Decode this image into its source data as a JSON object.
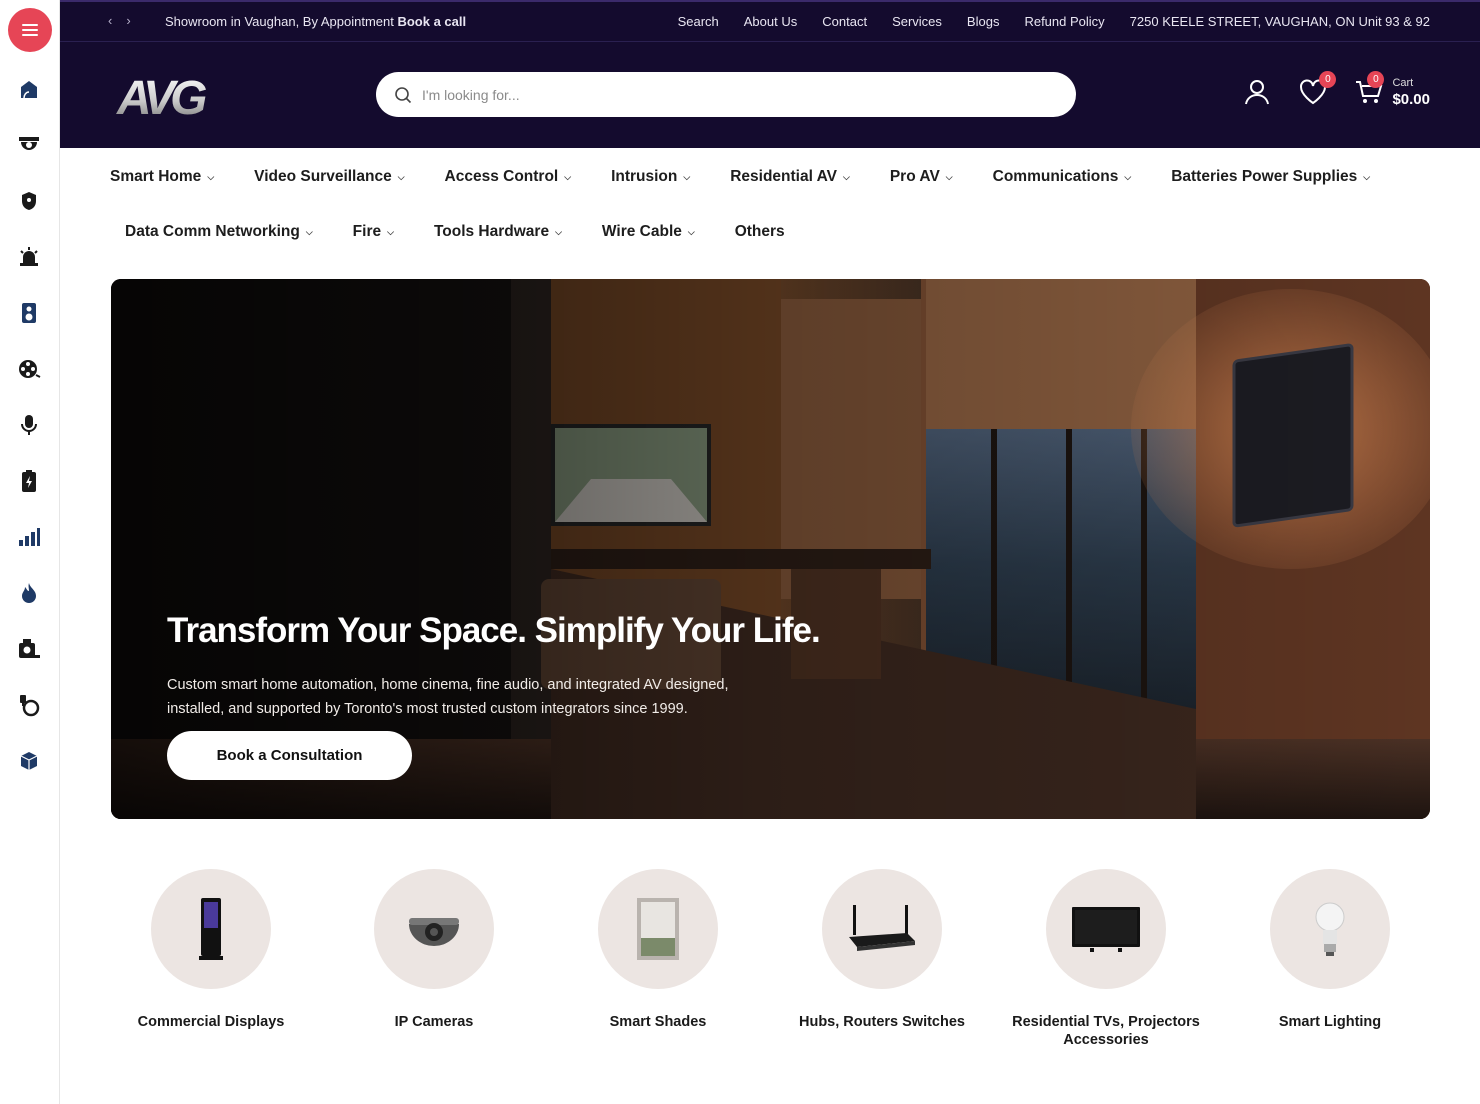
{
  "topbar": {
    "promo_text": "Showroom in Vaughan, By Appointment ",
    "promo_link": "Book a call",
    "links": [
      "Search",
      "About Us",
      "Contact",
      "Services",
      "Blogs",
      "Refund Policy",
      "7250 KEELE STREET, VAUGHAN, ON Unit 93 & 92"
    ]
  },
  "header": {
    "logo_text": "AVG",
    "search_placeholder": "I'm looking for...",
    "wishlist_count": "0",
    "cart_count": "0",
    "cart_label": "Cart",
    "cart_total": "$0.00"
  },
  "nav": {
    "row1": [
      "Smart Home",
      "Video Surveillance",
      "Access Control",
      "Intrusion",
      "Residential AV",
      "Pro AV",
      "Communications",
      "Batteries Power Supplies"
    ],
    "row2": [
      "Data Comm Networking",
      "Fire",
      "Tools Hardware",
      "Wire Cable",
      "Others"
    ]
  },
  "hero": {
    "title": "Transform Your Space. Simplify Your Life.",
    "subtitle": "Custom smart home automation, home cinema, fine audio, and integrated AV designed, installed, and supported by Toronto's most trusted custom integrators since 1999.",
    "cta": "Book a Consultation"
  },
  "categories": [
    "Commercial Displays",
    "IP Cameras",
    "Smart Shades",
    "Hubs, Routers Switches",
    "Residential TVs, Projectors Accessories",
    "Smart Lighting"
  ],
  "colors": {
    "header_bg": "#140b2e",
    "accent": "#e64556",
    "category_circle": "#ece5e2"
  }
}
